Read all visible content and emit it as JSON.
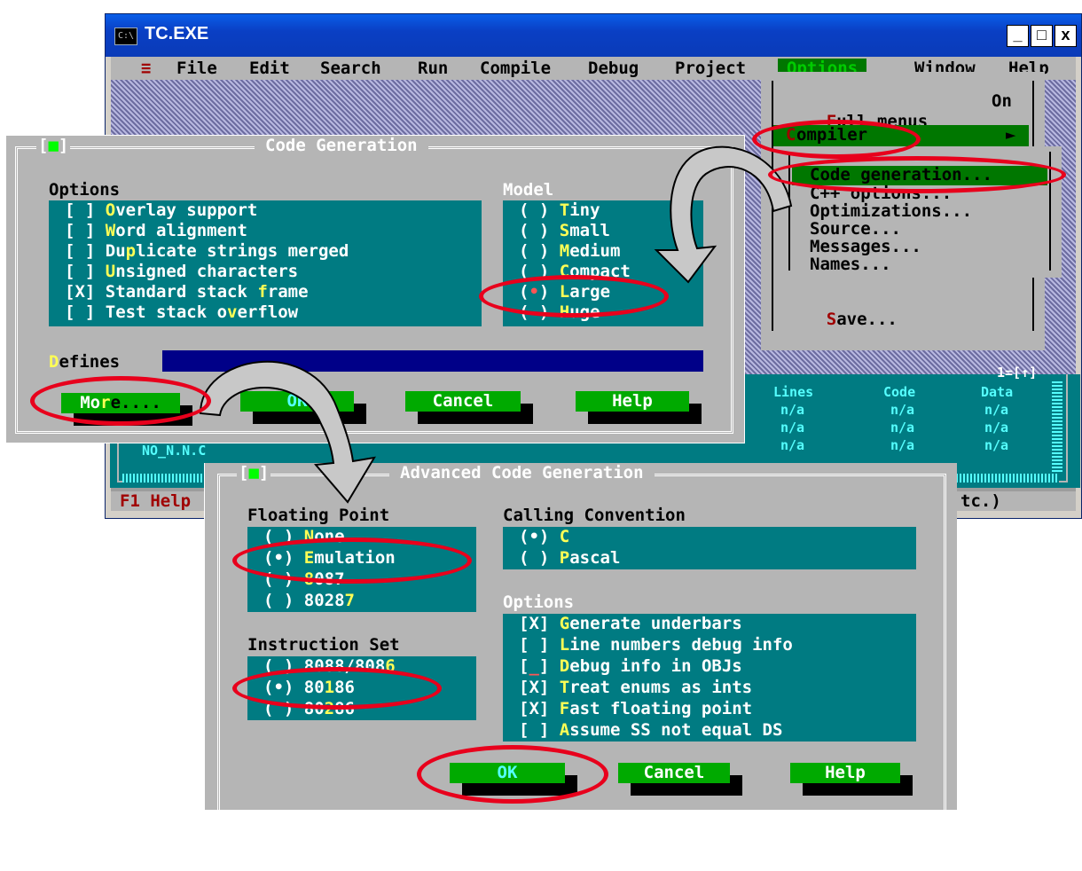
{
  "window": {
    "title": "TC.EXE",
    "icon_text": "C:\\",
    "controls": [
      "_",
      "□",
      "x"
    ]
  },
  "menubar": {
    "system": "≡",
    "items": [
      "File",
      "Edit",
      "Search",
      "Run",
      "Compile",
      "Debug",
      "Project",
      "Options",
      "Window",
      "Help"
    ],
    "active": "Options"
  },
  "options_menu": {
    "items": [
      {
        "label": "Full menus",
        "hotkey": "F",
        "value": "On"
      },
      {
        "label": "Compiler",
        "hotkey": "C",
        "arrow": "►"
      },
      {
        "label": "Save...",
        "hotkey": "S"
      }
    ]
  },
  "compiler_submenu": {
    "items": [
      {
        "label": "Code generation...",
        "hotkey": "C"
      },
      {
        "label": "C++ options...",
        "hotkey": "C"
      },
      {
        "label": "Optimizations...",
        "hotkey": "O"
      },
      {
        "label": "Source...",
        "hotkey": "S"
      },
      {
        "label": "Messages...",
        "hotkey": "M"
      },
      {
        "label": "Names...",
        "hotkey": "N"
      }
    ]
  },
  "project_window": {
    "headers": [
      "Lines",
      "Code",
      "Data"
    ],
    "rows": [
      [
        "n/a",
        "n/a",
        "n/a"
      ],
      [
        "n/a",
        "n/a",
        "n/a"
      ],
      [
        "n/a",
        "n/a",
        "n/a"
      ]
    ],
    "partial_file": "NO_N.N.C",
    "frame_label": "1=[↑]"
  },
  "status_bar": {
    "left": "F1 Help",
    "right": "tc.)"
  },
  "code_generation": {
    "title": "Code Generation",
    "close": "[■]",
    "options_label": "Options",
    "options": [
      {
        "mark": "[ ]",
        "label": "Overlay support",
        "hotkey_index": 0
      },
      {
        "mark": "[ ]",
        "label": "Word alignment",
        "hotkey_index": 0
      },
      {
        "mark": "[ ]",
        "label": "Duplicate strings merged",
        "hotkey_index": 2
      },
      {
        "mark": "[ ]",
        "label": "Unsigned characters",
        "hotkey_index": 0
      },
      {
        "mark": "[X]",
        "label": "Standard stack frame",
        "hotkey_index": 15
      },
      {
        "mark": "[ ]",
        "label": "Test stack overflow",
        "hotkey_index": 12
      }
    ],
    "model_label": "Model",
    "models": [
      {
        "mark": "( )",
        "label": "Tiny"
      },
      {
        "mark": "( )",
        "label": "Small"
      },
      {
        "mark": "( )",
        "label": "Medium"
      },
      {
        "mark": "( )",
        "label": "Compact"
      },
      {
        "mark": "(•)",
        "label": "Large"
      },
      {
        "mark": "( )",
        "label": "Huge"
      }
    ],
    "defines_label": "Defines",
    "defines_value": "",
    "buttons": {
      "more": "More....",
      "ok": "OK",
      "cancel": "Cancel",
      "help": "Help"
    }
  },
  "advanced": {
    "title": "Advanced Code Generation",
    "close": "[■]",
    "fp_label": "Floating Point",
    "fp": [
      {
        "mark": "( )",
        "label": "None"
      },
      {
        "mark": "(•)",
        "label": "Emulation"
      },
      {
        "mark": "( )",
        "label": "8087"
      },
      {
        "mark": "( )",
        "label": "80287"
      }
    ],
    "is_label": "Instruction Set",
    "is": [
      {
        "mark": "( )",
        "label": "8088/8086"
      },
      {
        "mark": "(•)",
        "label": "80186"
      },
      {
        "mark": "( )",
        "label": "80286"
      }
    ],
    "cc_label": "Calling Convention",
    "cc": [
      {
        "mark": "(•)",
        "label": "C"
      },
      {
        "mark": "( )",
        "label": "Pascal"
      }
    ],
    "opt_label": "Options",
    "opts": [
      {
        "mark": "[X]",
        "label": "Generate underbars"
      },
      {
        "mark": "[ ]",
        "label": "Line numbers debug info"
      },
      {
        "mark": "[_]",
        "label": "Debug info in OBJs"
      },
      {
        "mark": "[X]",
        "label": "Treat enums as ints"
      },
      {
        "mark": "[X]",
        "label": "Fast floating point"
      },
      {
        "mark": "[ ]",
        "label": "Assume SS not equal DS"
      }
    ],
    "buttons": {
      "ok": "OK",
      "cancel": "Cancel",
      "help": "Help"
    }
  },
  "colors": {
    "dos_cyan": "#007b82",
    "dos_gray": "#b5b5b5",
    "dos_green": "#00aa00",
    "hotkey_yellow": "#ffff55",
    "annotation_red": "#e8001c",
    "xp_title_blue": "#0a3fc4"
  }
}
